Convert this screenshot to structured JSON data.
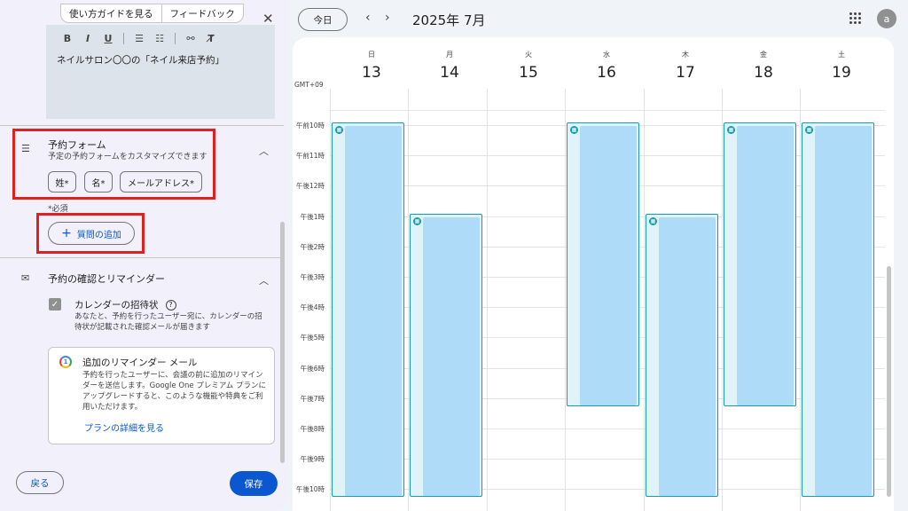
{
  "panel": {
    "tabs": [
      "使い方ガイドを見る",
      "フィードバック"
    ],
    "close_icon": "close-icon",
    "editor_text": "ネイルサロン〇〇の「ネイル来店予約」",
    "toolbar": [
      "B",
      "I",
      "U"
    ],
    "booking_form": {
      "title": "予約フォーム",
      "subtitle": "予定の予約フォームをカスタマイズできます",
      "chips": [
        "姓*",
        "名*",
        "メールアドレス*"
      ],
      "required_note": "*必須",
      "add_question": "質問の追加"
    },
    "reminders": {
      "title": "予約の確認とリマインダー",
      "invite_title": "カレンダーの招待状",
      "invite_desc": "あなたと、予約を行ったユーザー宛に、カレンダーの招待状が記載された確認メールが届きます",
      "card_title": "追加のリマインダー メール",
      "card_desc": "予約を行ったユーザーに、会議の前に追加のリマインダーを送信します。Google One プレミアム プランにアップグレードすると、このような機能や特典をご利用いただけます。",
      "card_link": "プランの詳細を見る",
      "g_one_badge": "1"
    },
    "back_button": "戻る",
    "save_button": "保存"
  },
  "header": {
    "today": "今日",
    "month": "2025年 7月",
    "avatar": "a"
  },
  "calendar": {
    "timezone": "GMT+09",
    "days": [
      {
        "name": "日",
        "num": "13"
      },
      {
        "name": "月",
        "num": "14"
      },
      {
        "name": "火",
        "num": "15"
      },
      {
        "name": "水",
        "num": "16"
      },
      {
        "name": "木",
        "num": "17"
      },
      {
        "name": "金",
        "num": "18"
      },
      {
        "name": "土",
        "num": "19"
      }
    ],
    "hours": [
      "午前10時",
      "午前11時",
      "午後12時",
      "午後1時",
      "午後2時",
      "午後3時",
      "午後4時",
      "午後5時",
      "午後6時",
      "午後7時",
      "午後8時",
      "午後9時",
      "午後10時"
    ],
    "availability": [
      {
        "day": "13",
        "start": "午前10時",
        "end": "午後10時"
      },
      {
        "day": "14",
        "start": "午後1時",
        "end": "午後10時"
      },
      {
        "day": "16",
        "start": "午前10時",
        "end": "午後7時"
      },
      {
        "day": "17",
        "start": "午後1時",
        "end": "午後10時"
      },
      {
        "day": "18",
        "start": "午前10時",
        "end": "午後7時"
      },
      {
        "day": "19",
        "start": "午前10時",
        "end": "午後10時"
      }
    ],
    "accent": "#129eaf",
    "slot_color": "#aedcf8"
  }
}
